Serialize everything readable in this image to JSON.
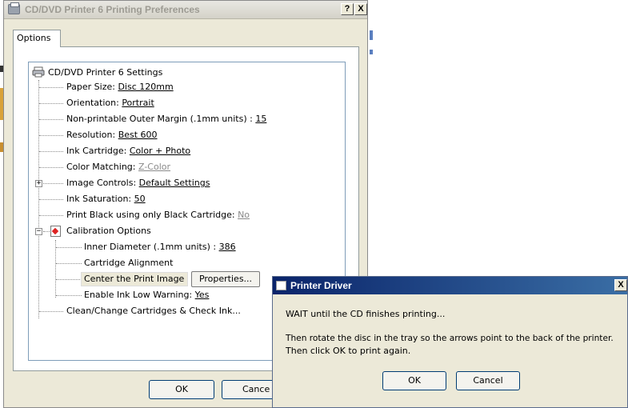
{
  "prefs_window": {
    "title": "CD/DVD Printer 6 Printing Preferences",
    "help_glyph": "?",
    "close_glyph": "X",
    "tab_label": "Options",
    "ok_label": "OK",
    "cancel_label": "Cance"
  },
  "tree": {
    "root_label": "CD/DVD Printer 6 Settings",
    "items": [
      {
        "label": "Paper Size: ",
        "value": "Disc 120mm "
      },
      {
        "label": "Orientation: ",
        "value": "Portrait"
      },
      {
        "label": "Non-printable Outer Margin (.1mm units) : ",
        "value": "15"
      },
      {
        "label": "Resolution: ",
        "value": "Best 600"
      },
      {
        "label": "Ink Cartridge: ",
        "value": "Color + Photo"
      },
      {
        "label": "Color Matching: ",
        "value": "Z-Color"
      },
      {
        "label": "Image Controls: ",
        "value": "Default Settings"
      },
      {
        "label": "Ink Saturation: ",
        "value": "50"
      },
      {
        "label": "Print Black using only Black Cartridge: ",
        "value": "No"
      }
    ],
    "calibration_label": "Calibration Options",
    "calibration_items": [
      {
        "label": "Inner Diameter (.1mm units) : ",
        "value": "386"
      },
      {
        "label": "Cartridge Alignment",
        "value": ""
      },
      {
        "label": "Center the Print Image",
        "value": ""
      },
      {
        "label": "Enable Ink Low Warning: ",
        "value": "Yes"
      }
    ],
    "properties_button": "Properties...",
    "clean_label": "Clean/Change Cartridges & Check Ink...",
    "expand_plus": "+",
    "expand_minus": "−"
  },
  "dialog": {
    "title": "Printer Driver",
    "close_glyph": "X",
    "line1": "WAIT until the CD finishes printing...",
    "line2": "Then rotate the disc in the tray so the arrows point to the back of the printer.",
    "line3": "Then click OK to print again.",
    "ok_label": "OK",
    "cancel_label": "Cancel"
  },
  "colors": {
    "dialog_title_start": "#0a246a",
    "dialog_title_end": "#3a6ea5",
    "window_face": "#ece9d8",
    "disabled_value": "#8a8a8a"
  }
}
